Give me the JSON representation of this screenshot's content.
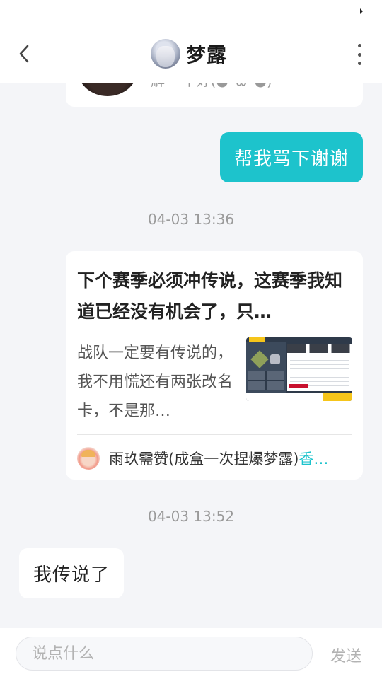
{
  "header": {
    "title": "梦露"
  },
  "previous_card": {
    "partial_text": "解 • 不好(●´ω`●)"
  },
  "messages": {
    "outgoing_1": "帮我骂下谢谢",
    "timestamp_1": "04-03 13:36",
    "shared_post": {
      "title": "下个赛季必须冲传说，这赛季我知道已经没有机会了，只…",
      "excerpt": "战队一定要有传说的，我不用慌还有两张改名卡，不是那…",
      "author": "雨玖需赞(成盒一次捏爆梦露)",
      "author_suffix": "香…"
    },
    "timestamp_2": "04-03 13:52",
    "incoming_1": "我传说了"
  },
  "composer": {
    "placeholder": "说点什么",
    "send_label": "发送"
  },
  "icons": {
    "back": "chevron-left-icon",
    "more": "more-vertical-icon"
  },
  "colors": {
    "accent": "#1dc3cc",
    "background": "#f4f5f8"
  }
}
